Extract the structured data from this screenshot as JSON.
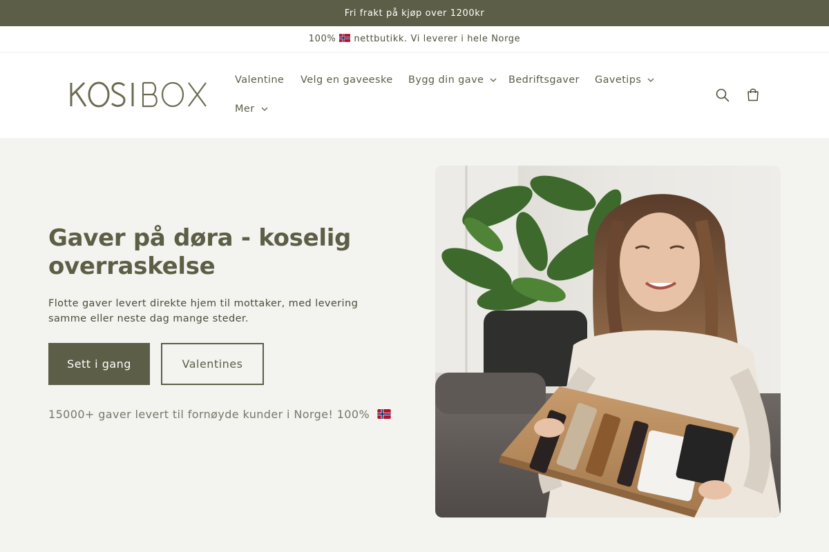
{
  "announcements": {
    "top": "Fri frakt på kjøp over 1200kr",
    "second_prefix": "100%",
    "second_suffix": "nettbutikk. Vi leverer i hele Norge"
  },
  "brand": {
    "logo_text": "KOSIBOX",
    "accent_color": "#5c5e47",
    "hero_bg": "#f3f3ef"
  },
  "nav": {
    "items": [
      {
        "label": "Valentine",
        "has_dropdown": false
      },
      {
        "label": "Velg en gaveeske",
        "has_dropdown": false
      },
      {
        "label": "Bygg din gave",
        "has_dropdown": true
      },
      {
        "label": "Bedriftsgaver",
        "has_dropdown": false
      },
      {
        "label": "Gavetips",
        "has_dropdown": true
      },
      {
        "label": "Mer",
        "has_dropdown": true
      }
    ]
  },
  "header_icons": {
    "search": "search-icon",
    "cart": "cart-icon"
  },
  "hero": {
    "title": "Gaver på døra - koselig overraskelse",
    "description": "Flotte gaver levert direkte hjem til mottaker, med levering samme eller neste dag mange steder.",
    "primary_button": "Sett i gang",
    "secondary_button": "Valentines",
    "note": "15000+ gaver levert til fornøyde kunder i Norge! 100%"
  }
}
